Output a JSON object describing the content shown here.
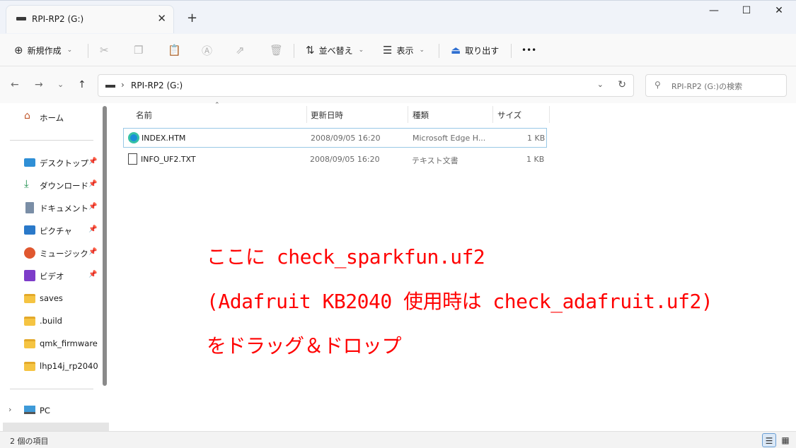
{
  "window": {
    "tab_title": "RPI-RP2 (G:)",
    "tab_close": "✕",
    "new_tab": "+",
    "minimize": "—",
    "maximize": "☐",
    "close": "✕"
  },
  "toolbar": {
    "new_label": "新規作成",
    "sort_label": "並べ替え",
    "view_label": "表示",
    "eject_label": "取り出す",
    "more": "•••"
  },
  "address": {
    "path": "RPI-RP2 (G:)",
    "separator": "›"
  },
  "search": {
    "placeholder": "RPI-RP2 (G:)の検索"
  },
  "sidebar": {
    "home": "ホーム",
    "quick_access": [
      {
        "label": "デスクトップ",
        "icon": "desktop-icon",
        "pinned": true
      },
      {
        "label": "ダウンロード",
        "icon": "download-icon",
        "pinned": true
      },
      {
        "label": "ドキュメント",
        "icon": "documents-icon",
        "pinned": true
      },
      {
        "label": "ピクチャ",
        "icon": "pictures-icon",
        "pinned": true
      },
      {
        "label": "ミュージック",
        "icon": "music-icon",
        "pinned": true
      },
      {
        "label": "ビデオ",
        "icon": "videos-icon",
        "pinned": true
      },
      {
        "label": "saves",
        "icon": "folder-icon",
        "pinned": false
      },
      {
        "label": ".build",
        "icon": "folder-icon",
        "pinned": false
      },
      {
        "label": "qmk_firmware",
        "icon": "folder-icon",
        "pinned": false
      },
      {
        "label": "lhp14j_rp2040",
        "icon": "folder-icon",
        "pinned": false
      }
    ],
    "pc": "PC"
  },
  "columns": {
    "name": "名前",
    "modified": "更新日時",
    "type": "種類",
    "size": "サイズ"
  },
  "files": [
    {
      "name": "INDEX.HTM",
      "modified": "2008/09/05 16:20",
      "type": "Microsoft Edge H...",
      "size": "1 KB",
      "icon": "edge-icon"
    },
    {
      "name": "INFO_UF2.TXT",
      "modified": "2008/09/05 16:20",
      "type": "テキスト文書",
      "size": "1 KB",
      "icon": "text-file-icon"
    }
  ],
  "annotation": {
    "line1": "ここに check_sparkfun.uf2",
    "line2": "(Adafruit KB2040 使用時は check_adafruit.uf2)",
    "line3": "をドラッグ＆ドロップ",
    "color": "#ff0000"
  },
  "status": {
    "item_count": "2 個の項目"
  }
}
